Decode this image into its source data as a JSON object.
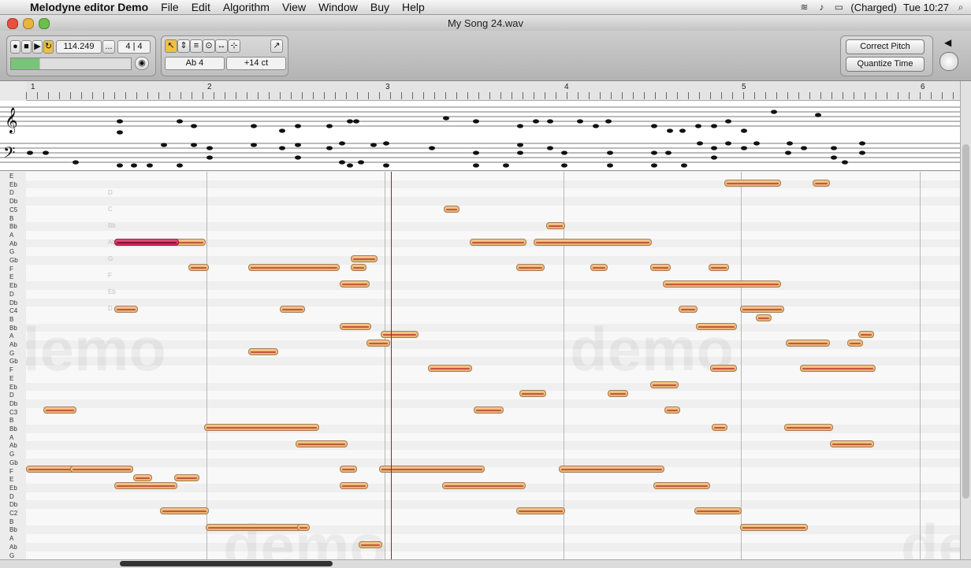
{
  "menubar": {
    "app_name": "Melodyne editor Demo",
    "items": [
      "File",
      "Edit",
      "Algorithm",
      "View",
      "Window",
      "Buy",
      "Help"
    ],
    "battery": "(Charged)",
    "clock": "Tue 10:27"
  },
  "window": {
    "title": "My Song 24.wav"
  },
  "transport": {
    "tempo": "114.249",
    "more": "...",
    "signature": "4 | 4"
  },
  "tools": {
    "pitch_readout": "Ab 4",
    "cents_readout": "+14 ct"
  },
  "right_panel": {
    "correct_pitch": "Correct Pitch",
    "quantize_time": "Quantize Time"
  },
  "ruler": {
    "bars": [
      "1",
      "2",
      "3",
      "4",
      "5",
      "6"
    ]
  },
  "keys": [
    "E",
    "Eb",
    "D",
    "Db",
    "C5",
    "B",
    "Bb",
    "A",
    "Ab",
    "G",
    "Gb",
    "F",
    "E",
    "Eb",
    "D",
    "Db",
    "C4",
    "B",
    "Bb",
    "A",
    "Ab",
    "G",
    "Gb",
    "F",
    "E",
    "Eb",
    "D",
    "Db",
    "C3",
    "B",
    "Bb",
    "A",
    "Ab",
    "G",
    "Gb",
    "F",
    "E",
    "Eb",
    "D",
    "Db",
    "C2",
    "B",
    "Bb",
    "A",
    "Ab",
    "G"
  ],
  "ghost_scale": [
    "D",
    "C",
    "Bb",
    "Ab",
    "G",
    "F",
    "Eb",
    "D"
  ],
  "watermark": "demo",
  "colors": {
    "note_fill": "#f4c58a",
    "note_selected": "#c42454",
    "playhead": "#7a2f2f"
  }
}
